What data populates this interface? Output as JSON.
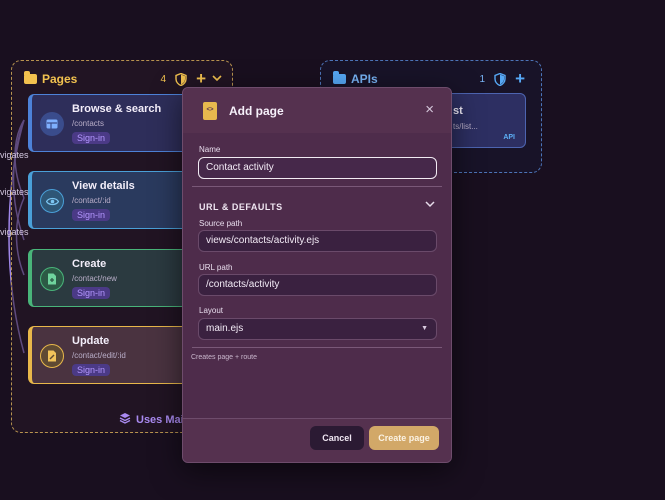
{
  "groups": {
    "pages": {
      "title": "Pages",
      "count": "4",
      "footer": "Uses Main"
    },
    "apis": {
      "title": "APIs",
      "count": "1"
    }
  },
  "nodes": [
    {
      "title": "Browse & search",
      "path": "/contacts",
      "badge": "Sign-in"
    },
    {
      "title": "View details",
      "path": "/contact/:id",
      "badge": "Sign-in"
    },
    {
      "title": "Create",
      "path": "/contact/new",
      "badge": "Sign-in"
    },
    {
      "title": "Update",
      "path": "/contact/edit/:id",
      "badge": "Sign-in"
    }
  ],
  "api_node": {
    "title": "st",
    "path": "ts/list...",
    "badge": "API"
  },
  "edge_labels": [
    "vigates",
    "vigates",
    "vigates"
  ],
  "modal": {
    "title": "Add page",
    "name_label": "Name",
    "name_value": "Contact activity",
    "section_title": "URL & DEFAULTS",
    "source_label": "Source path",
    "source_value": "views/contacts/activity.ejs",
    "url_label": "URL path",
    "url_value": "/contacts/activity",
    "layout_label": "Layout",
    "layout_value": "main.ejs",
    "helper": "Creates page + route",
    "cancel_label": "Cancel",
    "create_label": "Create page"
  },
  "colors": {
    "background": "#190f1f",
    "pages_accent": "#f2c24f",
    "apis_accent": "#56a8f5",
    "badge_text": "#b497ff",
    "modal_bg": "#4e2c4b",
    "primary_button": "#d2a868"
  }
}
